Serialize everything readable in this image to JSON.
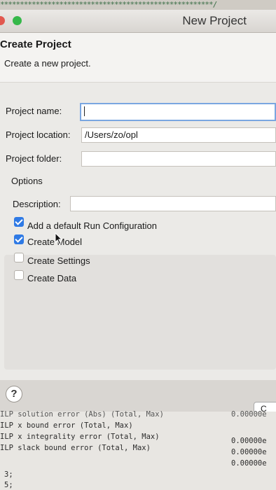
{
  "top_strip_text": "******************************************************/",
  "window": {
    "title": "New Project"
  },
  "header": {
    "title": "Create Project",
    "subtitle": "Create a new project."
  },
  "form": {
    "project_name_label": "Project name:",
    "project_name_value": "",
    "project_location_label": "Project location:",
    "project_location_value": "/Users/zo/opl",
    "project_folder_label": "Project folder:",
    "project_folder_value": ""
  },
  "options": {
    "heading": "Options",
    "description_label": "Description:",
    "description_value": "",
    "checkboxes": [
      {
        "label": "Add a default Run Configuration",
        "checked": true
      },
      {
        "label": "Create Model",
        "checked": true
      },
      {
        "label": "Create Settings",
        "checked": false
      },
      {
        "label": "Create Data",
        "checked": false
      }
    ]
  },
  "footer": {
    "help_symbol": "?",
    "partial_button_label": "C"
  },
  "console": {
    "lines": [
      "ILP solution error (Abs) (Total, Max)",
      "ILP x bound error (Total, Max)",
      "ILP x integrality error (Total, Max)",
      "ILP slack bound error (Total, Max)"
    ],
    "values": [
      "0.00000e",
      "0.00000e",
      "0.00000e",
      "0.00000e"
    ],
    "gutter": [
      "3;",
      "5;"
    ]
  }
}
